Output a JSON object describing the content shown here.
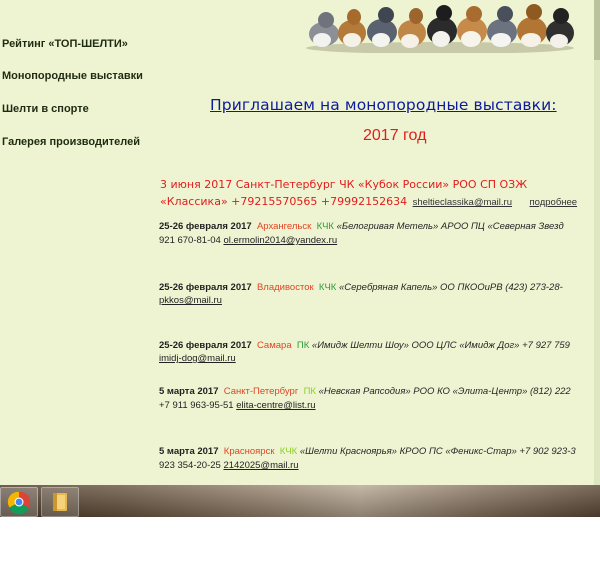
{
  "sidebar": {
    "items": [
      {
        "label": "Рейтинг «ТОП-ШЕЛТИ»"
      },
      {
        "label": "Монопородные выставки"
      },
      {
        "label": "Шелти в спорте"
      },
      {
        "label": "Галерея производителей"
      }
    ]
  },
  "main": {
    "title": "Приглашаем на монопородные выставки:",
    "year": "2017 год",
    "highlight": {
      "line1": "3 июня 2017  Санкт-Петербург  ЧК «Кубок России» РОО СП ОЗЖ",
      "line2": "«Классика» +79215570565  +79992152634",
      "email": "sheltieclassika@mail.ru",
      "more": "подробнее"
    },
    "events": [
      {
        "date": "25-26 февраля 2017",
        "city": "Архангельск",
        "club": "КЧК",
        "text": "«Белогривая Метель»  АРОО ПЦ «Северная Звезд",
        "line2": "921 670-81-04",
        "email": "ol.ermolin2014@yandex.ru"
      },
      {
        "date": "25-26 февраля 2017",
        "city": "Владивосток",
        "club": "КЧК",
        "text": "«Серебряная Капель» ОО ПКООиРВ (423) 273-28-",
        "line2": "",
        "email": "pkkos@mail.ru"
      },
      {
        "date": "25-26 февраля 2017",
        "city": "Самара",
        "club": "ПК",
        "text": "«Имидж Шелти Шоу» ООО ЦЛС «Имидж Дог» +7 927 759",
        "line2": "",
        "email": "imidj-dog@mail.ru"
      },
      {
        "date": "5 марта 2017",
        "city": "Санкт-Петербург",
        "club": "ПК",
        "text": "«Невская Рапсодия»  РОО КО «Элита-Центр» (812) 222",
        "line2": "+7 911 963-95-51",
        "email": "elita-centre@list.ru"
      },
      {
        "date": "5 марта 2017",
        "city": "Красноярск",
        "club": "КЧК",
        "text": "«Шелти Красноярья» КРОО ПС «Феникс-Стар» +7 902 923-3",
        "line2": "923 354-20-25",
        "email": "2142025@mail.ru"
      }
    ]
  },
  "taskbar": {
    "apps": [
      {
        "icon": "chrome-icon"
      },
      {
        "icon": "folder-icon"
      }
    ]
  },
  "colors": {
    "page_bg": "#eef4d2",
    "title": "#0d1a9c",
    "red": "#e21c1c",
    "city": "#e04524",
    "club": "#2e9c3a",
    "club_light": "#8ecf2a"
  }
}
